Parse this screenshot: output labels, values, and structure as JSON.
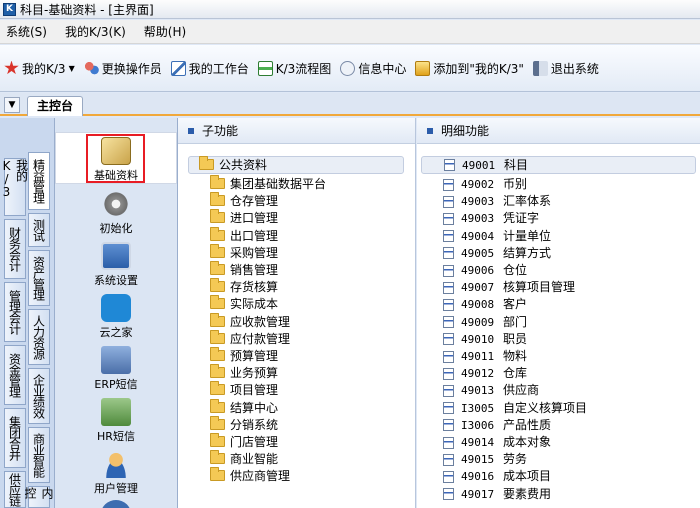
{
  "window": {
    "title": "科目-基础资料 - [主界面]",
    "logo": "K"
  },
  "menu": [
    {
      "label": "系统(S)"
    },
    {
      "label": "我的K/3(K)"
    },
    {
      "label": "帮助(H)"
    }
  ],
  "toolbar": [
    {
      "label": "我的K/3",
      "icon": "star-icon",
      "color": "#d9342b",
      "dropdown": true
    },
    {
      "label": "更换操作员",
      "icon": "users-icon",
      "color": "#c0392b"
    },
    {
      "label": "我的工作台",
      "icon": "pencil-icon",
      "color": "#3b6fb6"
    },
    {
      "label": "K/3流程图",
      "icon": "flowchart-icon",
      "color": "#2e7d32"
    },
    {
      "label": "信息中心",
      "icon": "message-icon",
      "color": "#7a8aa6"
    },
    {
      "label": "添加到\"我的K/3\"",
      "icon": "add-icon",
      "color": "#e0a21a"
    },
    {
      "label": "退出系统",
      "icon": "exit-icon",
      "color": "#5c6f8e"
    }
  ],
  "tabs": {
    "main": "主控台"
  },
  "vertical_tabs": {
    "outer": [
      "我的K/3",
      "财务会计",
      "管理会计",
      "资金管理",
      "集团合并",
      "供应链"
    ],
    "inner": [
      "精益管理",
      "测试",
      "资产管理",
      "人力资源",
      "企业绩效",
      "商业智能",
      "内控"
    ]
  },
  "functions": [
    {
      "label": "基础资料",
      "icon": "basic-data-icon",
      "color": "#c9a34a"
    },
    {
      "label": "初始化",
      "icon": "gear-icon",
      "color": "#8c8c8c"
    },
    {
      "label": "系统设置",
      "icon": "computer-icon",
      "color": "#3d6db0"
    },
    {
      "label": "云之家",
      "icon": "cloud-icon",
      "color": "#1f88d6"
    },
    {
      "label": "ERP短信",
      "icon": "sms-icon",
      "color": "#5a7fb8"
    },
    {
      "label": "HR短信",
      "icon": "hr-sms-icon",
      "color": "#4f8a3c"
    },
    {
      "label": "用户管理",
      "icon": "user-icon",
      "color": "#e2a03a"
    }
  ],
  "sub_panel": {
    "title": "子功能",
    "items": [
      "公共资料",
      "集团基础数据平台",
      "仓存管理",
      "进口管理",
      "出口管理",
      "采购管理",
      "销售管理",
      "存货核算",
      "实际成本",
      "应收款管理",
      "应付款管理",
      "预算管理",
      "业务预算",
      "项目管理",
      "结算中心",
      "分销系统",
      "门店管理",
      "商业智能",
      "供应商管理"
    ]
  },
  "detail_panel": {
    "title": "明细功能",
    "items": [
      {
        "code": "49001",
        "name": "科目"
      },
      {
        "code": "49002",
        "name": "币别"
      },
      {
        "code": "49003",
        "name": "汇率体系"
      },
      {
        "code": "49003",
        "name": "凭证字"
      },
      {
        "code": "49004",
        "name": "计量单位"
      },
      {
        "code": "49005",
        "name": "结算方式"
      },
      {
        "code": "49006",
        "name": "仓位"
      },
      {
        "code": "49007",
        "name": "核算项目管理"
      },
      {
        "code": "49008",
        "name": "客户"
      },
      {
        "code": "49009",
        "name": "部门"
      },
      {
        "code": "49010",
        "name": "职员"
      },
      {
        "code": "49011",
        "name": "物料"
      },
      {
        "code": "49012",
        "name": "仓库"
      },
      {
        "code": "49013",
        "name": "供应商"
      },
      {
        "code": "I3005",
        "name": "自定义核算项目"
      },
      {
        "code": "I3006",
        "name": "产品性质"
      },
      {
        "code": "49014",
        "name": "成本对象"
      },
      {
        "code": "49015",
        "name": "劳务"
      },
      {
        "code": "49016",
        "name": "成本项目"
      },
      {
        "code": "49017",
        "name": "要素费用"
      }
    ]
  },
  "colors": {
    "highlight_border": "#e81c24",
    "tab_accent": "#f1a83a"
  }
}
